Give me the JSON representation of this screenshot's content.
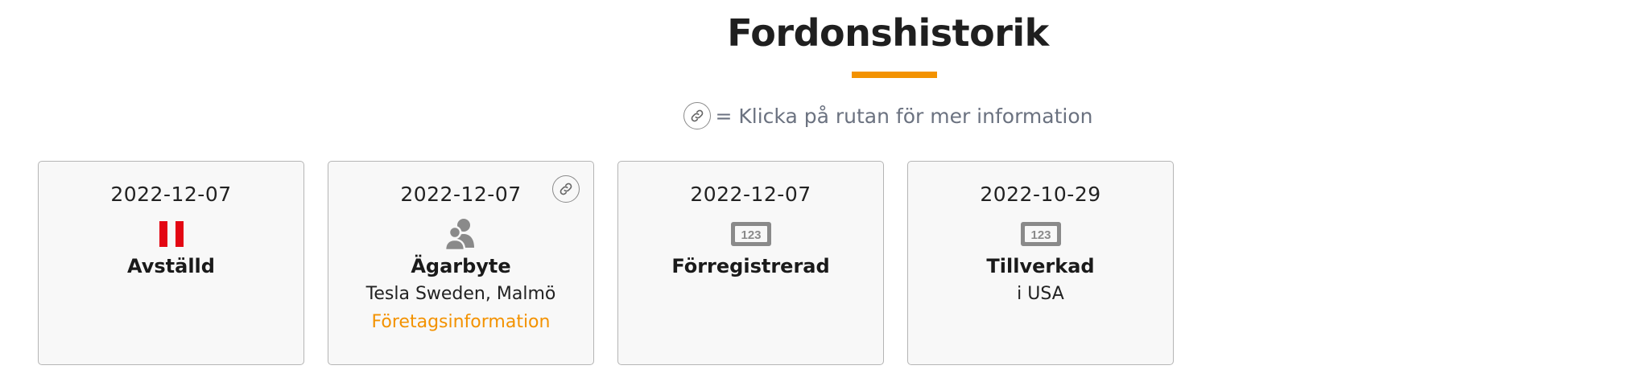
{
  "header": {
    "title": "Fordonshistorik",
    "legend_text": "= Klicka på rutan för mer information",
    "legend_icon": "link-icon"
  },
  "colors": {
    "accent": "#f39200",
    "status_red": "#e30613",
    "icon_gray": "#8a8a8a"
  },
  "events": [
    {
      "date": "2022-12-07",
      "icon": "pause-icon",
      "label": "Avställd",
      "detail": "",
      "link": "",
      "has_link_badge": false
    },
    {
      "date": "2022-12-07",
      "icon": "owners-icon",
      "label": "Ägarbyte",
      "detail": "Tesla Sweden, Malmö",
      "link": "Företagsinformation",
      "has_link_badge": true
    },
    {
      "date": "2022-12-07",
      "icon": "license-plate-icon",
      "label": "Förregistrerad",
      "detail": "",
      "link": "",
      "has_link_badge": false
    },
    {
      "date": "2022-10-29",
      "icon": "license-plate-icon",
      "label": "Tillverkad",
      "detail": "i USA",
      "link": "",
      "has_link_badge": false
    }
  ],
  "plate_icon_text": "123"
}
